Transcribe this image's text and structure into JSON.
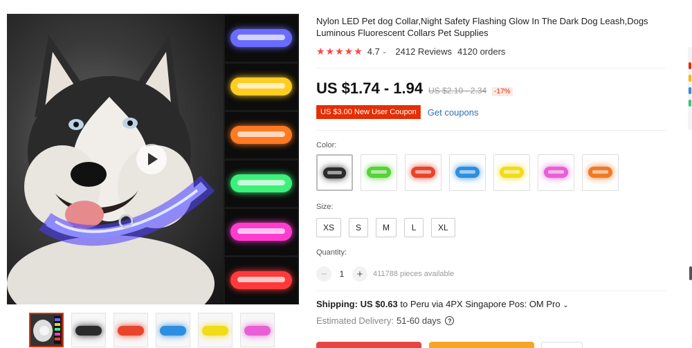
{
  "product": {
    "title": "Nylon LED Pet dog Collar,Night Safety Flashing Glow In The Dark Dog Leash,Dogs Luminous Fluorescent Collars Pet Supplies"
  },
  "rating": {
    "stars": "★★★★★",
    "score": "4.7",
    "caret": "⌄",
    "reviews": "2412 Reviews",
    "orders": "4120 orders"
  },
  "price": {
    "current": "US $1.74 - 1.94",
    "original": "US $2.10 - 2.34",
    "discount": "-17%"
  },
  "coupon": {
    "label": "US $3.00 New User Coupon",
    "link": "Get coupons"
  },
  "color": {
    "label": "Color:",
    "options": [
      {
        "name": "black",
        "hex": "#2b2b2b"
      },
      {
        "name": "green",
        "hex": "#58d13a"
      },
      {
        "name": "red",
        "hex": "#e8442b"
      },
      {
        "name": "blue",
        "hex": "#2e8fe0"
      },
      {
        "name": "yellow",
        "hex": "#f2dc1a"
      },
      {
        "name": "pink",
        "hex": "#e85fd6"
      },
      {
        "name": "orange",
        "hex": "#ef7a26"
      }
    ]
  },
  "size": {
    "label": "Size:",
    "options": [
      "XS",
      "S",
      "M",
      "L",
      "XL"
    ]
  },
  "quantity": {
    "label": "Quantity:",
    "minus": "−",
    "value": "1",
    "plus": "+",
    "available": "411788 pieces available"
  },
  "shipping": {
    "label": "Shipping:",
    "cost": "US $0.63",
    "details": " to Peru via 4PX Singapore Pos: OM Pro",
    "caret": "⌄"
  },
  "delivery": {
    "label": "Estimated Delivery:",
    "days": "51-60 days",
    "help": "?"
  },
  "gallery": {
    "strip_colors": [
      "#6a6cff",
      "#ffcc22",
      "#ff7a22",
      "#3cf07a",
      "#ff3ccf",
      "#ff3a3a"
    ],
    "thumb_colors": [
      "#2b2b2b",
      "#e8442b",
      "#2e8fe0",
      "#f2dc1a",
      "#e85fd6"
    ]
  }
}
